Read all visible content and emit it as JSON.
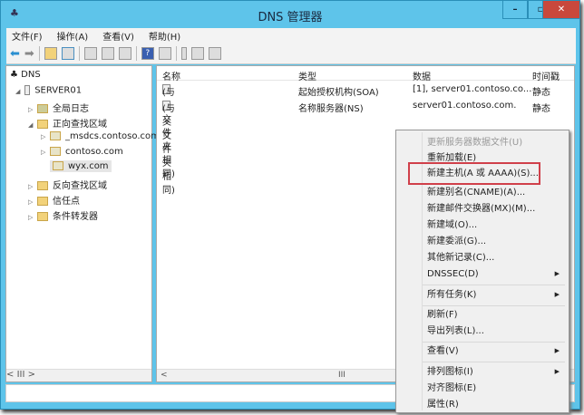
{
  "window": {
    "title": "DNS 管理器",
    "minimize": "–",
    "maximize": "▫",
    "close": "✕"
  },
  "menubar": [
    "文件(F)",
    "操作(A)",
    "查看(V)",
    "帮助(H)"
  ],
  "tree": {
    "root": "DNS",
    "server": "SERVER01",
    "items": [
      "全局日志",
      "正向查找区域",
      "_msdcs.contoso.com",
      "contoso.com",
      "wyx.com",
      "反向查找区域",
      "信任点",
      "条件转发器"
    ]
  },
  "list": {
    "columns": [
      "名称",
      "类型",
      "数据",
      "时间戳"
    ],
    "rows": [
      {
        "name": "(与父文件夹相同)",
        "type": "起始授权机构(SOA)",
        "data": "[1], server01.contoso.co...",
        "ts": "静态"
      },
      {
        "name": "(与父文件夹相同)",
        "type": "名称服务器(NS)",
        "data": "server01.contoso.com.",
        "ts": "静态"
      }
    ]
  },
  "context_menu": [
    "更新服务器数据文件(U)",
    "重新加载(E)",
    "新建主机(A 或 AAAA)(S)...",
    "新建别名(CNAME)(A)...",
    "新建邮件交换器(MX)(M)...",
    "新建域(O)...",
    "新建委派(G)...",
    "其他新记录(C)...",
    "DNSSEC(D)",
    "所有任务(K)",
    "刷新(F)",
    "导出列表(L)...",
    "查看(V)",
    "排列图标(I)",
    "对齐图标(E)",
    "属性(R)"
  ],
  "scroll": {
    "left": "<",
    "right": ">",
    "thumb": "III"
  }
}
